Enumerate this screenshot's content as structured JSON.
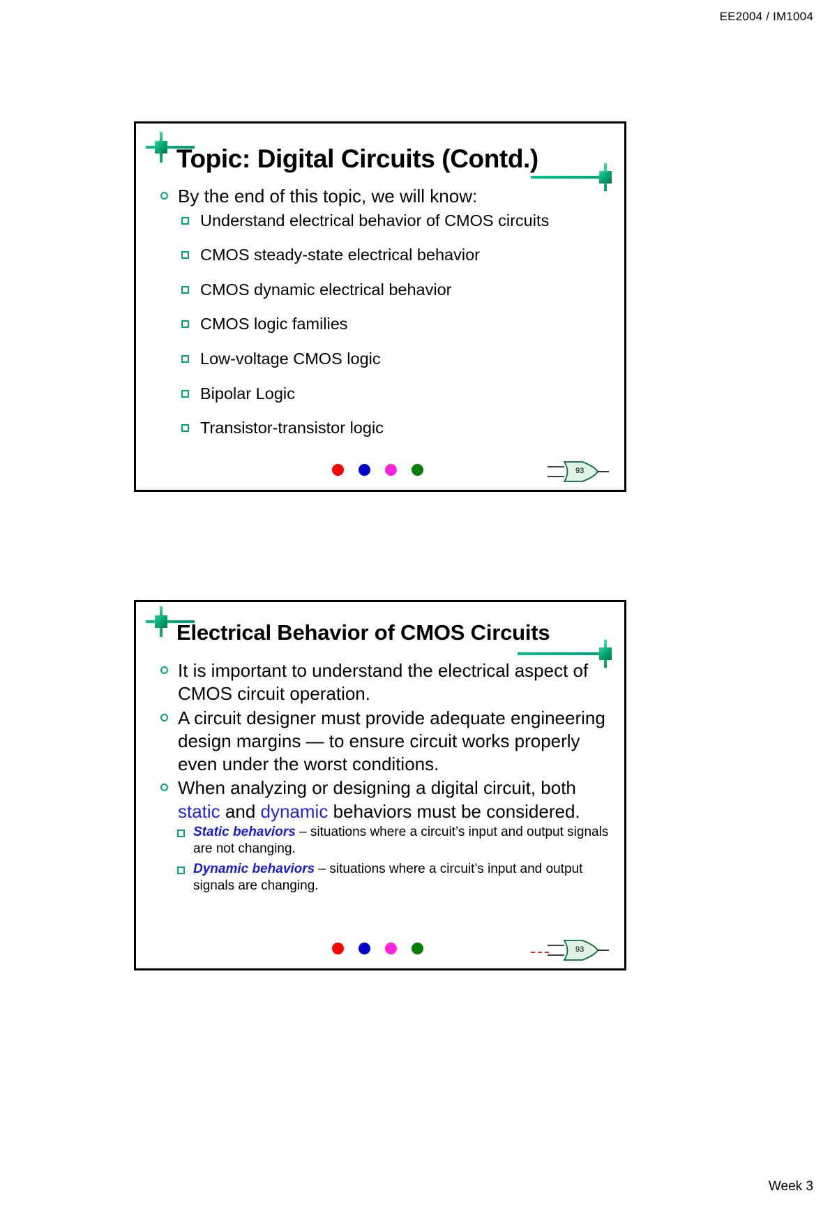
{
  "page": {
    "header": "EE2004 / IM1004",
    "footer": "Week 3"
  },
  "theme": {
    "accent_teal": "#00a57a",
    "marker_green_dark": "#007a52",
    "link_blue": "#2222dd",
    "dot_colors": [
      "#ff0000",
      "#0000cc",
      "#ff22dd",
      "#008000"
    ],
    "badge_green": "#008000",
    "red_dash": "#cc3322"
  },
  "slides": [
    {
      "id": "slide-1",
      "title": "Topic: Digital Circuits (Contd.)",
      "page_number": "93",
      "has_red_dash": false,
      "bullets": [
        {
          "level": 1,
          "text": "By the end of this topic, we will know:"
        },
        {
          "level": 2,
          "text": "Understand electrical behavior of CMOS circuits"
        },
        {
          "level": 2,
          "text": "CMOS steady-state electrical behavior"
        },
        {
          "level": 2,
          "text": "CMOS dynamic electrical behavior"
        },
        {
          "level": 2,
          "text": "CMOS logic families"
        },
        {
          "level": 2,
          "text": "Low-voltage CMOS logic"
        },
        {
          "level": 2,
          "text": "Bipolar Logic"
        },
        {
          "level": 2,
          "text": "Transistor-transistor logic"
        }
      ]
    },
    {
      "id": "slide-2",
      "title": "Electrical Behavior of CMOS Circuits",
      "page_number": "93",
      "has_red_dash": true,
      "bullets": [
        {
          "level": 1,
          "text": "It is important to understand the electrical aspect of CMOS circuit operation."
        },
        {
          "level": 1,
          "text": "A circuit designer must provide adequate engineering design margins — to ensure circuit works properly even under the worst conditions."
        },
        {
          "level": 1,
          "rich": true,
          "parts": [
            {
              "text": "When analyzing or designing a digital circuit, both ",
              "style": "plain"
            },
            {
              "text": "static",
              "style": "kw-blue"
            },
            {
              "text": " and ",
              "style": "plain"
            },
            {
              "text": "dynamic",
              "style": "kw-blue"
            },
            {
              "text": " behaviors must be considered.",
              "style": "plain"
            }
          ]
        },
        {
          "level": 2,
          "rich": true,
          "parts": [
            {
              "text": "Static behaviors",
              "style": "lead-bold"
            },
            {
              "text": " – situations where a circuit’s input and output signals are not changing.",
              "style": "plain"
            }
          ]
        },
        {
          "level": 2,
          "rich": true,
          "parts": [
            {
              "text": "Dynamic behaviors",
              "style": "lead-bold"
            },
            {
              "text": " – situations where a circuit’s input and output signals are changing.",
              "style": "plain"
            }
          ]
        }
      ]
    }
  ]
}
